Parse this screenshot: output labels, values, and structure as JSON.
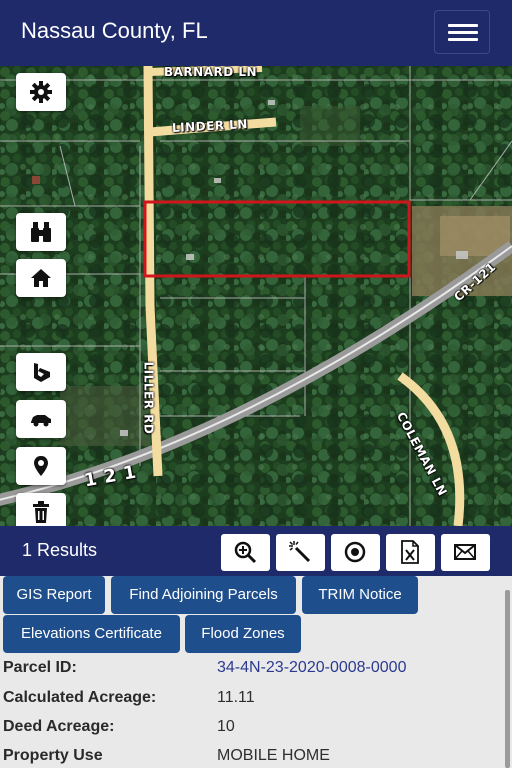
{
  "header": {
    "title": "Nassau County, FL"
  },
  "map": {
    "roads": {
      "barnard": "BARNARD LN",
      "linder": "LINDER LN",
      "liller": "LILLER RD",
      "coleman": "COLEMAN LN",
      "cr121": "CR-121",
      "route": "1 2 1"
    },
    "controls": [
      "gear-icon",
      "binoculars-icon",
      "home-icon",
      "bing-icon",
      "car-icon",
      "location-pin-icon",
      "trash-icon"
    ]
  },
  "results": {
    "count_label": "1 Results",
    "tools": [
      "zoom-in-icon",
      "magic-wand-icon",
      "target-icon",
      "excel-export-icon",
      "email-icon"
    ]
  },
  "actions": {
    "gis_report": "GIS Report",
    "find_adjoining": "Find Adjoining Parcels",
    "trim_notice": "TRIM Notice",
    "elevations": "Elevations Certificate",
    "flood_zones": "Flood Zones"
  },
  "parcel": {
    "rows": [
      {
        "label": "Parcel ID:",
        "value": "34-4N-23-2020-0008-0000"
      },
      {
        "label": "Calculated Acreage:",
        "value": "11.11"
      },
      {
        "label": "Deed Acreage:",
        "value": "10"
      },
      {
        "label": "Property Use",
        "value": "MOBILE HOME"
      }
    ]
  },
  "colors": {
    "header": "#1f2a6b",
    "button": "#1f4e8c",
    "parcel_outline": "#d0161b",
    "road": "#f3dca0"
  }
}
